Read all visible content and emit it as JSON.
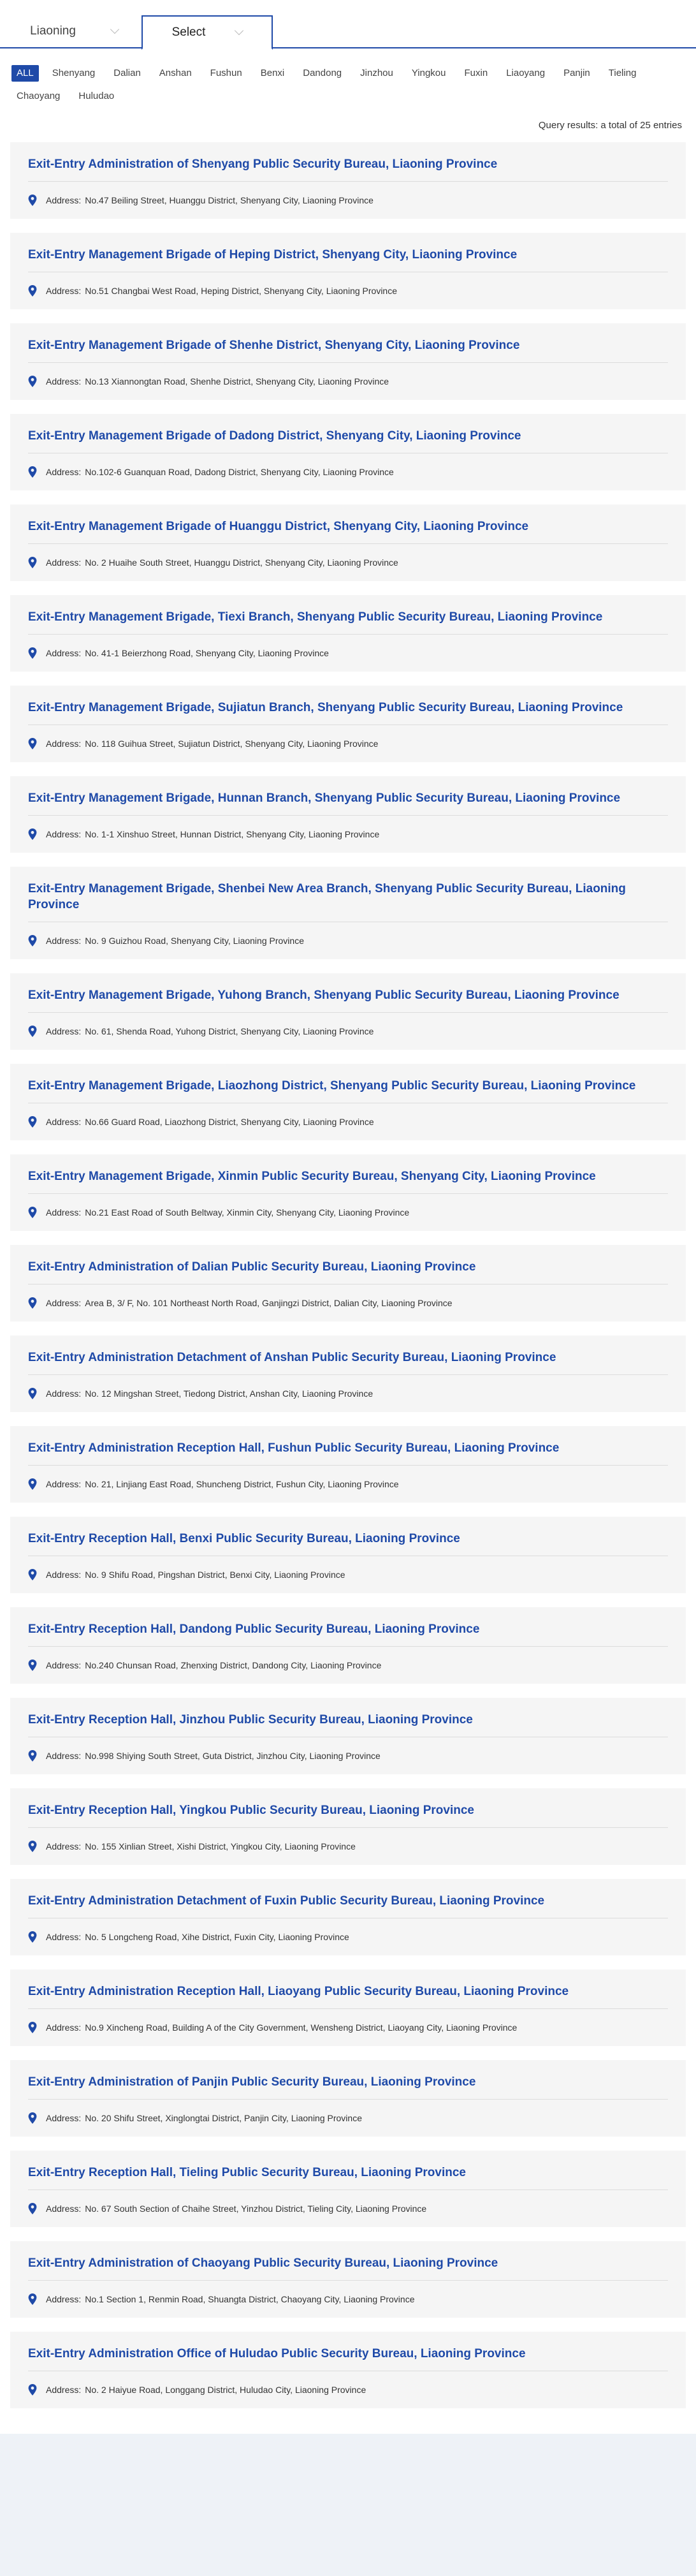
{
  "selectors": {
    "province": "Liaoning",
    "city": "Select"
  },
  "filters": [
    "ALL",
    "Shenyang",
    "Dalian",
    "Anshan",
    "Fushun",
    "Benxi",
    "Dandong",
    "Jinzhou",
    "Yingkou",
    "Fuxin",
    "Liaoyang",
    "Panjin",
    "Tieling",
    "Chaoyang",
    "Huludao"
  ],
  "active_filter": "ALL",
  "result_count": "Query results: a total of 25 entries",
  "address_label": "Address:",
  "colors": {
    "accent": "#1f4aa8",
    "card_bg": "#f5f5f5",
    "page_bg": "#eef2f7"
  },
  "entries": [
    {
      "title": "Exit-Entry Administration of Shenyang Public Security Bureau, Liaoning Province",
      "address": "No.47 Beiling Street, Huanggu District, Shenyang City, Liaoning Province"
    },
    {
      "title": "Exit-Entry Management Brigade of Heping District, Shenyang City, Liaoning Province",
      "address": "No.51 Changbai West Road, Heping District, Shenyang City, Liaoning Province"
    },
    {
      "title": "Exit-Entry Management Brigade of Shenhe District, Shenyang City, Liaoning Province",
      "address": "No.13 Xiannongtan Road, Shenhe District, Shenyang City, Liaoning Province"
    },
    {
      "title": "Exit-Entry Management Brigade of Dadong District, Shenyang City, Liaoning Province",
      "address": "No.102-6 Guanquan Road, Dadong District, Shenyang City, Liaoning Province"
    },
    {
      "title": "Exit-Entry Management Brigade of Huanggu District, Shenyang City, Liaoning Province",
      "address": "No. 2 Huaihe South Street, Huanggu District, Shenyang City, Liaoning Province"
    },
    {
      "title": "Exit-Entry Management Brigade, Tiexi Branch, Shenyang Public Security Bureau, Liaoning Province",
      "address": "No. 41-1 Beierzhong Road, Shenyang City, Liaoning Province"
    },
    {
      "title": "Exit-Entry Management Brigade, Sujiatun Branch, Shenyang Public Security Bureau, Liaoning Province",
      "address": "No. 118 Guihua Street, Sujiatun District, Shenyang City, Liaoning Province"
    },
    {
      "title": "Exit-Entry Management Brigade, Hunnan Branch, Shenyang Public Security Bureau, Liaoning Province",
      "address": "No. 1-1 Xinshuo Street, Hunnan District, Shenyang City, Liaoning Province"
    },
    {
      "title": "Exit-Entry Management Brigade, Shenbei New Area Branch, Shenyang Public Security Bureau, Liaoning Province",
      "address": "No. 9 Guizhou Road, Shenyang City, Liaoning Province"
    },
    {
      "title": "Exit-Entry Management Brigade, Yuhong Branch, Shenyang Public Security Bureau, Liaoning Province",
      "address": "No. 61, Shenda Road, Yuhong District, Shenyang City, Liaoning Province"
    },
    {
      "title": "Exit-Entry Management Brigade, Liaozhong District, Shenyang Public Security Bureau, Liaoning Province",
      "address": "No.66 Guard Road, Liaozhong District, Shenyang City, Liaoning Province"
    },
    {
      "title": "Exit-Entry Management Brigade, Xinmin Public Security Bureau, Shenyang City, Liaoning Province",
      "address": "No.21 East Road of South Beltway, Xinmin City, Shenyang City, Liaoning Province"
    },
    {
      "title": "Exit-Entry Administration of Dalian Public Security Bureau, Liaoning Province",
      "address": "Area B, 3/ F, No. 101 Northeast North Road, Ganjingzi District, Dalian City, Liaoning Province"
    },
    {
      "title": "Exit-Entry Administration Detachment of Anshan Public Security Bureau, Liaoning Province",
      "address": "No. 12 Mingshan Street, Tiedong District, Anshan City, Liaoning Province"
    },
    {
      "title": "Exit-Entry Administration Reception Hall, Fushun Public Security Bureau, Liaoning Province",
      "address": "No. 21, Linjiang East Road, Shuncheng District, Fushun City, Liaoning Province"
    },
    {
      "title": "Exit-Entry Reception Hall, Benxi Public Security Bureau, Liaoning Province",
      "address": "No. 9 Shifu Road, Pingshan District, Benxi City, Liaoning Province"
    },
    {
      "title": "Exit-Entry Reception Hall, Dandong Public Security Bureau, Liaoning Province",
      "address": "No.240 Chunsan Road, Zhenxing District, Dandong City, Liaoning Province"
    },
    {
      "title": "Exit-Entry Reception Hall, Jinzhou Public Security Bureau, Liaoning Province",
      "address": "No.998 Shiying South Street, Guta District, Jinzhou City, Liaoning Province"
    },
    {
      "title": "Exit-Entry Reception Hall, Yingkou Public Security Bureau, Liaoning Province",
      "address": "No. 155 Xinlian Street, Xishi District, Yingkou City, Liaoning Province"
    },
    {
      "title": "Exit-Entry Administration Detachment of Fuxin Public Security Bureau, Liaoning Province",
      "address": "No. 5 Longcheng Road, Xihe District, Fuxin City, Liaoning Province"
    },
    {
      "title": "Exit-Entry Administration Reception Hall, Liaoyang Public Security Bureau, Liaoning Province",
      "address": "No.9 Xincheng Road, Building A of the City Government, Wensheng District, Liaoyang City, Liaoning Province"
    },
    {
      "title": "Exit-Entry Administration of Panjin Public Security Bureau, Liaoning Province",
      "address": "No. 20 Shifu Street, Xinglongtai District, Panjin City, Liaoning Province"
    },
    {
      "title": "Exit-Entry Reception Hall, Tieling Public Security Bureau, Liaoning Province",
      "address": "No. 67 South Section of Chaihe Street, Yinzhou District, Tieling City, Liaoning Province"
    },
    {
      "title": "Exit-Entry Administration of Chaoyang Public Security Bureau, Liaoning Province",
      "address": "No.1 Section 1, Renmin Road, Shuangta District, Chaoyang City, Liaoning Province"
    },
    {
      "title": "Exit-Entry Administration Office of Huludao Public Security Bureau, Liaoning Province",
      "address": "No. 2 Haiyue Road, Longgang District, Huludao City, Liaoning Province"
    }
  ]
}
